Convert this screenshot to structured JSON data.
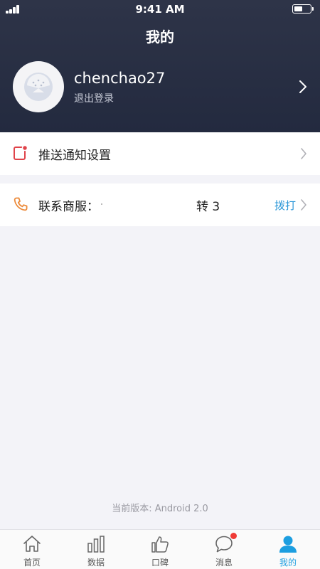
{
  "status_bar": {
    "time": "9:41 AM",
    "battery_level": 0.55
  },
  "header": {
    "title": "我的"
  },
  "profile": {
    "username": "chenchao27",
    "logout_label": "退出登录",
    "avatar_icon": "default-avatar-icon",
    "chevron_icon": "chevron-right-icon"
  },
  "settings": {
    "push_label": "推送通知设置",
    "push_icon": "notification-icon",
    "contact_label": "联系商服：",
    "contact_icon": "phone-icon",
    "transfer_label": "转 3",
    "dial_label": "拨打"
  },
  "footer": {
    "version": "当前版本: Android 2.0"
  },
  "tabbar": {
    "items": [
      {
        "label": "首页",
        "icon": "home-icon",
        "active": false
      },
      {
        "label": "数据",
        "icon": "bar-chart-icon",
        "active": false
      },
      {
        "label": "口碑",
        "icon": "thumbs-up-icon",
        "active": false
      },
      {
        "label": "消息",
        "icon": "message-icon",
        "active": false,
        "badge": true
      },
      {
        "label": "我的",
        "icon": "person-icon",
        "active": true
      }
    ]
  },
  "colors": {
    "header_bg": "#272e43",
    "accent": "#1c9ee0",
    "link": "#2d98d8",
    "badge": "#ef3b36",
    "push_icon": "#e0434a",
    "phone_icon": "#ec8a3a"
  }
}
